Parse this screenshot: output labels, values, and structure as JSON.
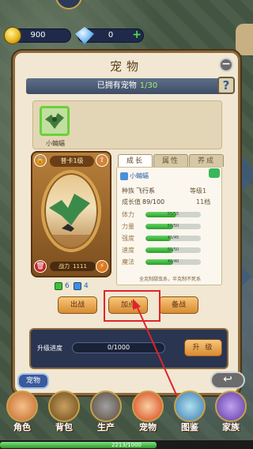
{
  "resources": {
    "gold": "900",
    "gems": "0",
    "add_label": "+"
  },
  "panel": {
    "title": "宠物",
    "close_label": "−",
    "owned_label": "已拥有宠物",
    "owned_count": "1/30",
    "help_label": "?"
  },
  "pet_list": [
    {
      "name": "小蝙蝠"
    }
  ],
  "portrait": {
    "card_title": "普卡1级",
    "power_label": "战力",
    "power_value": "1111",
    "green_count": "6",
    "blue_count": "4"
  },
  "tabs": [
    {
      "label": "成长"
    },
    {
      "label": "属性"
    },
    {
      "label": "养成"
    }
  ],
  "info": {
    "name": "小蝙蝠",
    "species_label": "种族",
    "species_value": "飞行系",
    "level_label": "等级",
    "level_value": "1",
    "growth_label": "成长值",
    "growth_value": "89/100",
    "grade_value": "11档",
    "stats": [
      {
        "label": "体力",
        "text": "55/55",
        "fraction": 0.55
      },
      {
        "label": "力量",
        "text": "50/50",
        "fraction": 0.5
      },
      {
        "label": "强度",
        "text": "45/45",
        "fraction": 0.45
      },
      {
        "label": "速度",
        "text": "50/50",
        "fraction": 0.5
      },
      {
        "label": "魔法",
        "text": "40/40",
        "fraction": 0.5
      }
    ],
    "note": "全克制甜虫系，半克制不死系"
  },
  "actions": {
    "battle": "出战",
    "add_points": "加点",
    "standby": "备战"
  },
  "upgrade": {
    "label": "升级进度",
    "progress": "0/1000",
    "button": "升 级"
  },
  "pet_tag": "宠物",
  "back_label": "↩",
  "nav": [
    {
      "label": "角色"
    },
    {
      "label": "背包"
    },
    {
      "label": "生产"
    },
    {
      "label": "宠物"
    },
    {
      "label": "图鉴"
    },
    {
      "label": "家族"
    }
  ],
  "xp": {
    "text": "2213/1000",
    "fraction": 0.62
  },
  "colors": {
    "highlight": "#e0242a",
    "accent_green": "#6cd03a",
    "panel_bg": "#f1e7d2"
  }
}
